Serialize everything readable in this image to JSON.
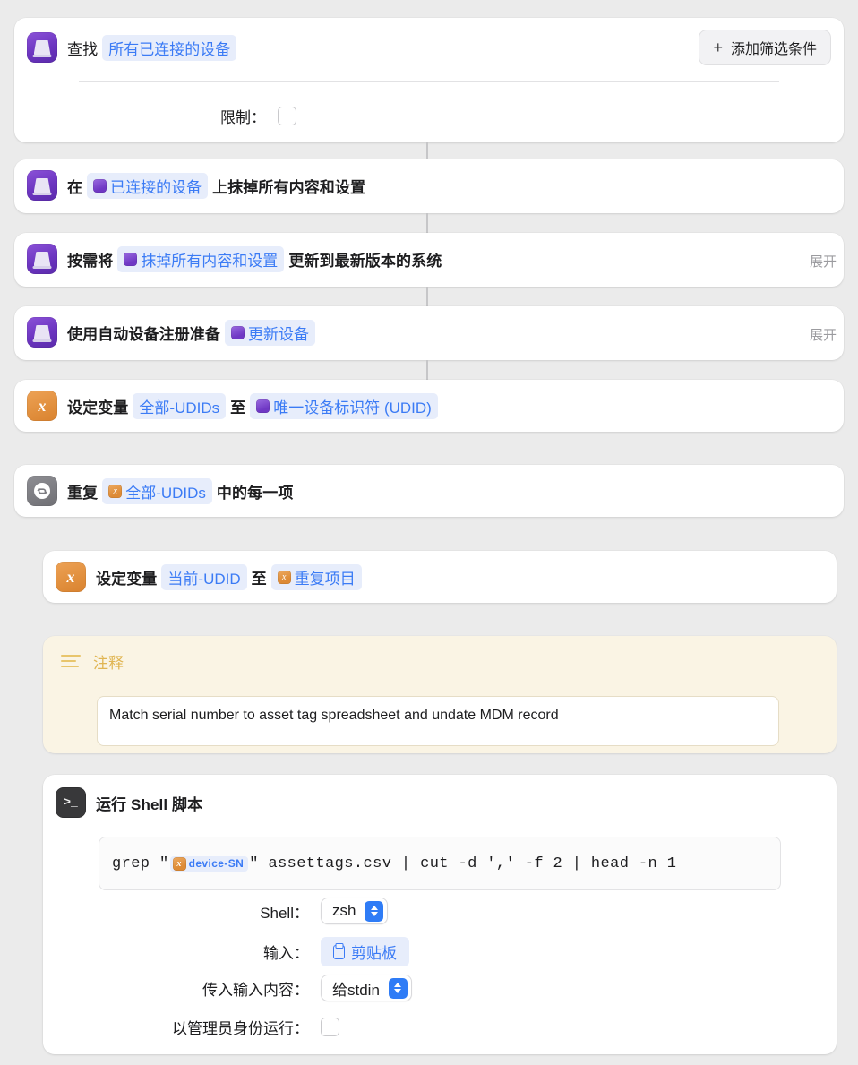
{
  "theme": {
    "background": "#ebebeb",
    "card_background": "#ffffff",
    "token_blue": "#3b7bf5",
    "token_bg": "#e7edfb",
    "comment_yellow": "#faf4e4",
    "comment_accent": "#e0b552",
    "device_purple": "#6c35c0",
    "variable_orange": "#e18f3d",
    "repeat_gray": "#8e8e93",
    "shell_dark": "#38383a",
    "stepper_blue": "#2f7cf6"
  },
  "actions": {
    "find_devices": {
      "icon": "device-icon",
      "prefix": "查找",
      "target_token": "所有已连接的设备",
      "add_filter_label": "添加筛选条件",
      "add_filter_plus": "+",
      "limit_label": "限制：",
      "limit_checked": false
    },
    "erase_device": {
      "icon": "device-icon",
      "prefix": "在",
      "token": "已连接的设备",
      "suffix": "上抹掉所有内容和设置"
    },
    "update_system": {
      "icon": "device-icon",
      "prefix": "按需将",
      "token": "抹掉所有内容和设置",
      "suffix": "更新到最新版本的系统",
      "expand_label": "展开"
    },
    "prepare_device": {
      "icon": "device-icon",
      "prefix": "使用自动设备注册准备",
      "token": "更新设备",
      "expand_label": "展开"
    },
    "set_all_udids": {
      "icon": "variable-icon",
      "prefix": "设定变量",
      "variable_token": "全部-UDIDs",
      "middle": "至",
      "value_token": "唯一设备标识符 (UDID)"
    },
    "repeat_each": {
      "icon": "repeat-icon",
      "prefix": "重复",
      "token": "全部-UDIDs",
      "suffix": "中的每一项"
    },
    "set_current_udid": {
      "icon": "variable-icon",
      "prefix": "设定变量",
      "variable_token": "当前-UDID",
      "middle": "至",
      "value_token": "重复项目"
    },
    "comment": {
      "icon": "comment-lines-icon",
      "title": "注释",
      "text": "Match serial number to asset tag spreadsheet and undate MDM record"
    },
    "run_shell_script": {
      "icon": "terminal-icon",
      "title": "运行 Shell 脚本",
      "script": {
        "before_token": "grep \"",
        "token": "device-SN",
        "after_token": "\" assettags.csv | cut -d ',' -f 2 | head -n 1"
      },
      "fields": {
        "shell": {
          "label": "Shell：",
          "value": "zsh"
        },
        "input": {
          "label": "输入：",
          "value": "剪贴板",
          "icon": "clipboard-icon"
        },
        "pass_input": {
          "label": "传入输入内容：",
          "value": "给stdin"
        },
        "run_as_admin": {
          "label": "以管理员身份运行：",
          "checked": false
        }
      }
    }
  }
}
